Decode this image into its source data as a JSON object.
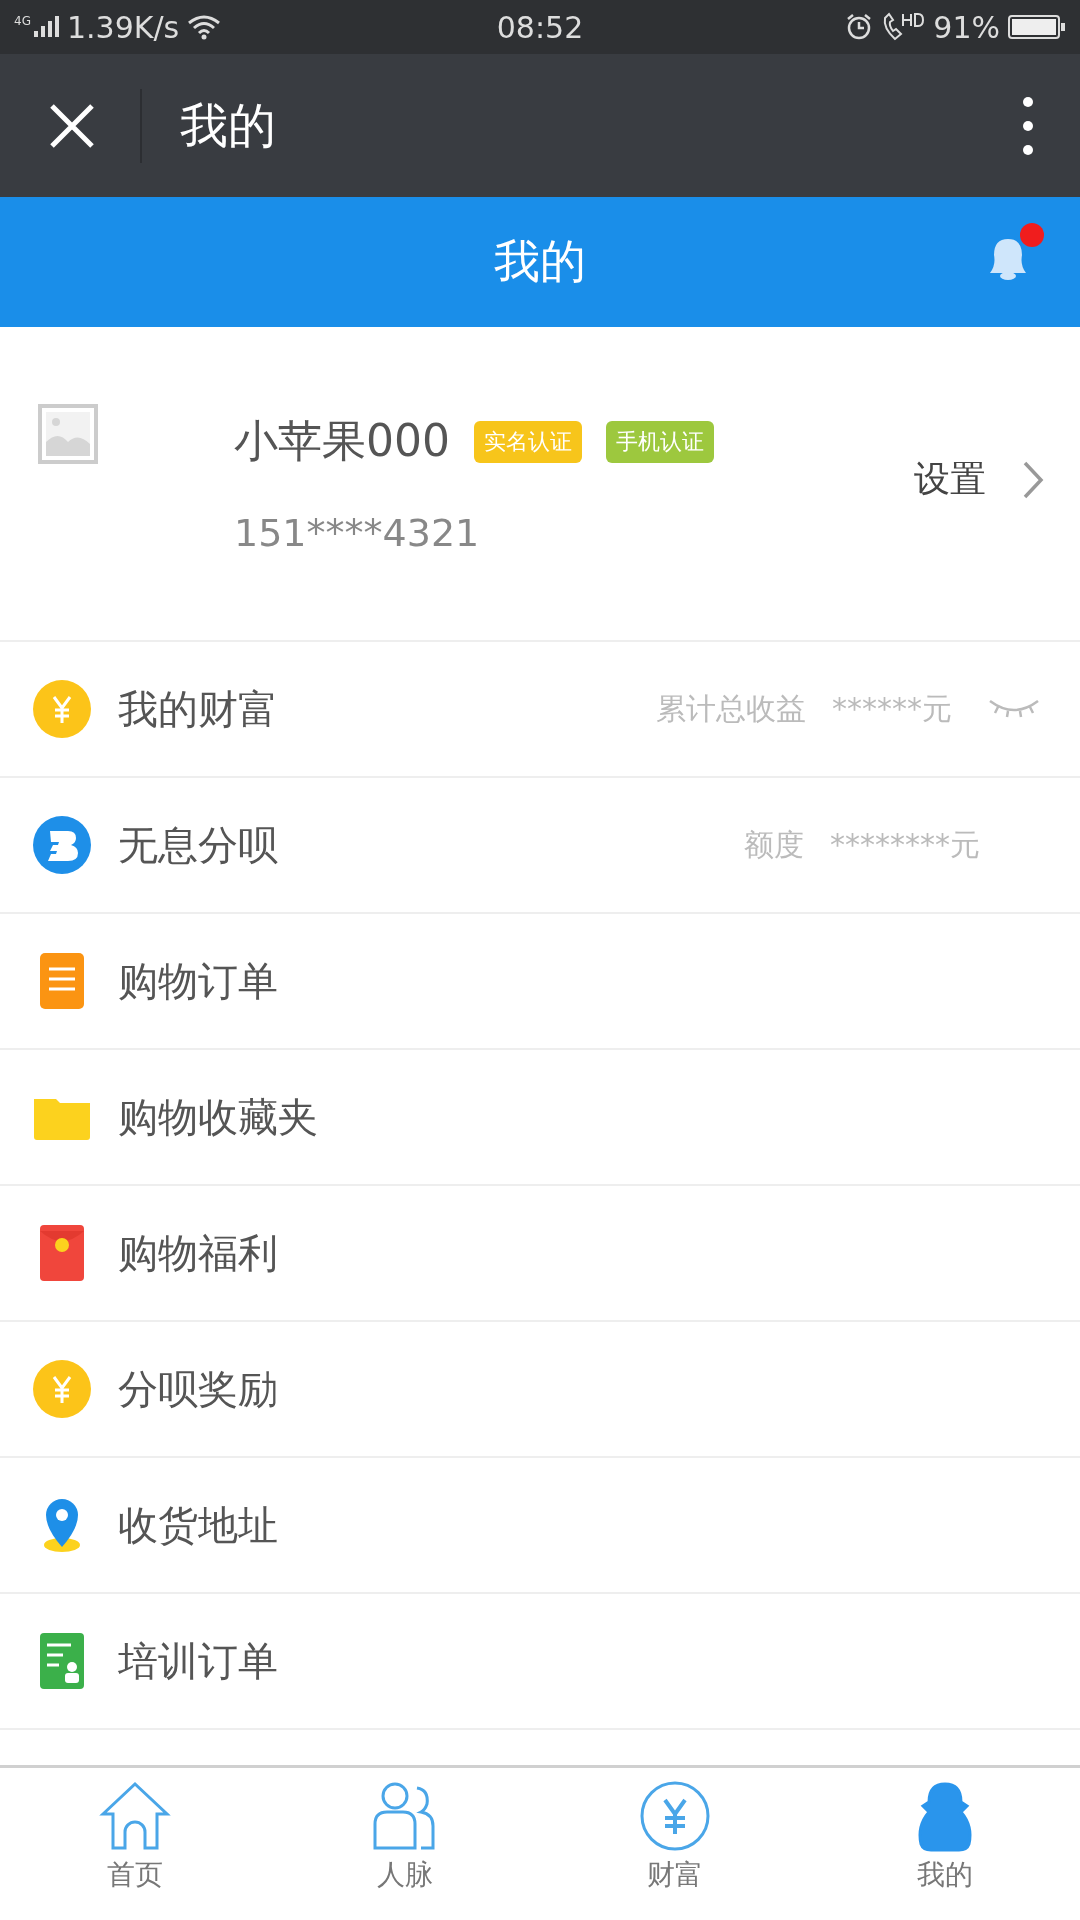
{
  "status_bar": {
    "network": "4G",
    "speed": "1.39K/s",
    "time": "08:52",
    "battery": "91%"
  },
  "title_bar": {
    "title": "我的"
  },
  "header": {
    "title": "我的",
    "notification": true
  },
  "profile": {
    "name": "小苹果000",
    "badges": [
      {
        "label": "实名认证",
        "color": "#f7c51b"
      },
      {
        "label": "手机认证",
        "color": "#9dc83e"
      }
    ],
    "phone": "151****4321",
    "settings": "设置"
  },
  "menu": [
    {
      "kind": "yen",
      "label": "我的财富",
      "note": "累计总收益",
      "value": "******元",
      "eye": true
    },
    {
      "kind": "b",
      "label": "无息分呗",
      "note": "额度",
      "value": "********元",
      "eye": false
    },
    {
      "kind": "order",
      "label": "购物订单"
    },
    {
      "kind": "folder",
      "label": "购物收藏夹"
    },
    {
      "kind": "packet",
      "label": "购物福利"
    },
    {
      "kind": "yen",
      "label": "分呗奖励"
    },
    {
      "kind": "pin",
      "label": "收货地址"
    },
    {
      "kind": "training",
      "label": "培训订单"
    }
  ],
  "tabs": [
    {
      "kind": "home",
      "label": "首页",
      "selected": false
    },
    {
      "kind": "people",
      "label": "人脉",
      "selected": false
    },
    {
      "kind": "wealth",
      "label": "财富",
      "selected": false
    },
    {
      "kind": "me",
      "label": "我的",
      "selected": true
    }
  ]
}
